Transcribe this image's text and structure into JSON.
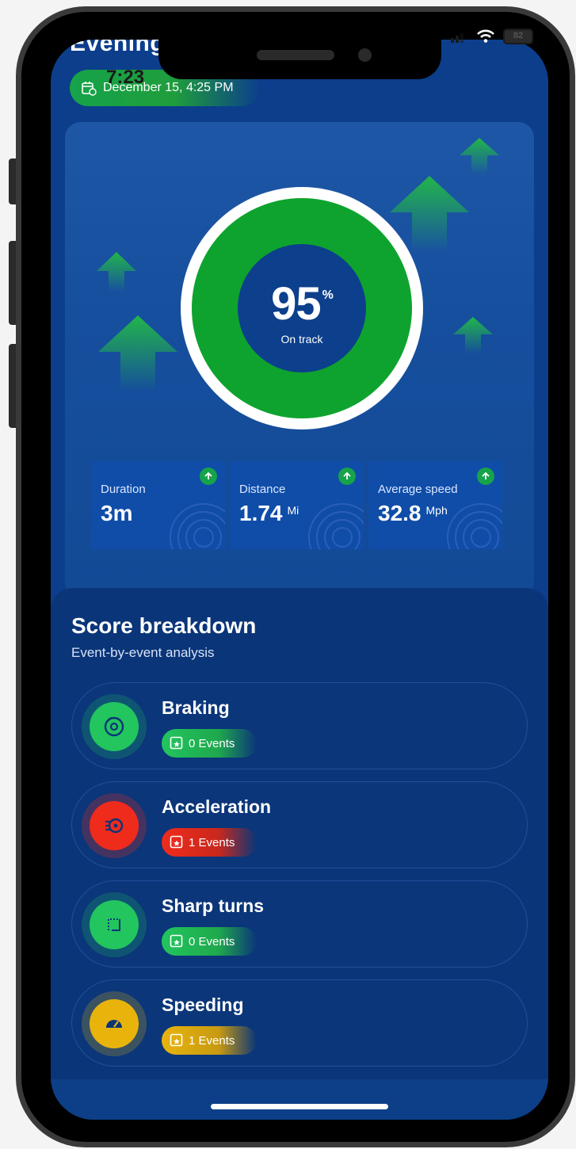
{
  "status_bar": {
    "time": "7:23",
    "battery": "82"
  },
  "header": {
    "title": "Evening",
    "date": "December 15, 4:25 PM"
  },
  "score": {
    "value": "95",
    "unit": "%",
    "caption": "On track",
    "fraction": 0.95
  },
  "stats": [
    {
      "label": "Duration",
      "value": "3m",
      "unit": ""
    },
    {
      "label": "Distance",
      "value": "1.74",
      "unit": "Mi"
    },
    {
      "label": "Average speed",
      "value": "32.8",
      "unit": "Mph"
    }
  ],
  "breakdown": {
    "title": "Score breakdown",
    "subtitle": "Event-by-event analysis",
    "items": [
      {
        "name": "Braking",
        "events": "0 Events",
        "color": "#22c55e",
        "icon": "brake-disc-icon"
      },
      {
        "name": "Acceleration",
        "events": "1 Events",
        "color": "#ef2b1c",
        "icon": "acceleration-icon"
      },
      {
        "name": "Sharp turns",
        "events": "0 Events",
        "color": "#22c55e",
        "icon": "sharp-turn-icon"
      },
      {
        "name": "Speeding",
        "events": "1 Events",
        "color": "#e8b40c",
        "icon": "speedometer-icon"
      }
    ]
  },
  "colors": {
    "background": "#0c3e8c",
    "accent_green": "#16a34a",
    "danger": "#ef2b1c",
    "warning": "#e8b40c"
  }
}
